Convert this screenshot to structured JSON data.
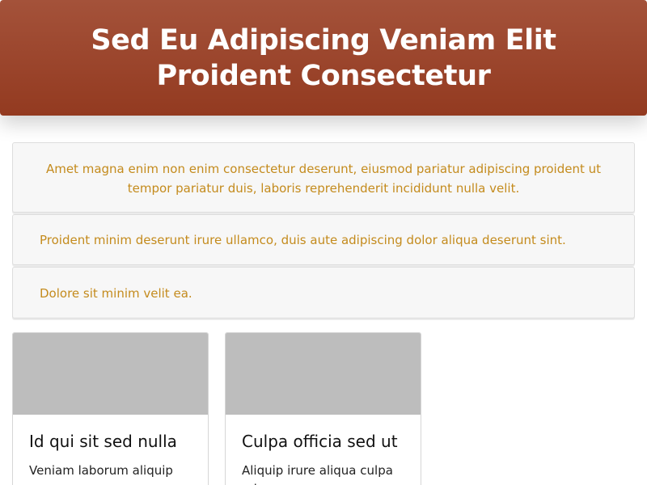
{
  "header": {
    "title": "Sed Eu Adipiscing Veniam Elit Proident Consectetur"
  },
  "accordion": {
    "items": [
      {
        "text": "Amet magna enim non enim consectetur deserunt, eiusmod pariatur adipiscing proident ut tempor pariatur duis, laboris reprehenderit incididunt nulla velit."
      },
      {
        "text": "Proident minim deserunt irure ullamco, duis aute adipiscing dolor aliqua deserunt sint."
      },
      {
        "text": "Dolore sit minim velit ea."
      }
    ]
  },
  "cards": [
    {
      "title": "Id qui sit sed nulla",
      "text": "Veniam laborum aliquip"
    },
    {
      "title": "Culpa officia sed ut",
      "text": "Aliquip irure aliqua culpa ad"
    }
  ],
  "colors": {
    "header_top": "#a4523a",
    "header_bottom": "#933a20",
    "accordion_text": "#c48b1d",
    "panel_background": "#f7f7f7",
    "image_placeholder": "#bdbdbd"
  }
}
